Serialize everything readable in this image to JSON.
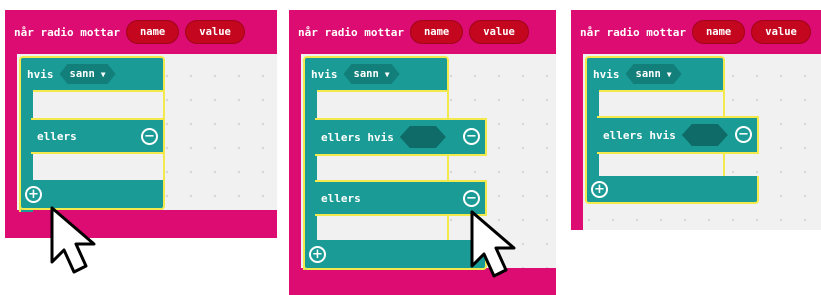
{
  "panels": [
    {
      "event_label": "når radio mottar",
      "params": [
        "name",
        "value"
      ],
      "if_label": "hvis",
      "condition": "sann",
      "else_if_label": "",
      "else_label": "ellers"
    },
    {
      "event_label": "når radio mottar",
      "params": [
        "name",
        "value"
      ],
      "if_label": "hvis",
      "condition": "sann",
      "else_if_label": "ellers hvis",
      "else_label": "ellers"
    },
    {
      "event_label": "når radio mottar",
      "params": [
        "name",
        "value"
      ],
      "if_label": "hvis",
      "condition": "sann",
      "else_if_label": "ellers hvis",
      "else_label": ""
    }
  ],
  "icons": {
    "remove": "minus-circle-icon",
    "add": "plus-circle-icon",
    "dropdown": "chevron-down-icon",
    "cursor": "mouse-pointer-icon"
  },
  "colors": {
    "event": "#dc0c72",
    "param": "#c4071e",
    "logic": "#1a9b96",
    "highlight": "#f3e94c",
    "workspace": "#f1f1f1"
  }
}
